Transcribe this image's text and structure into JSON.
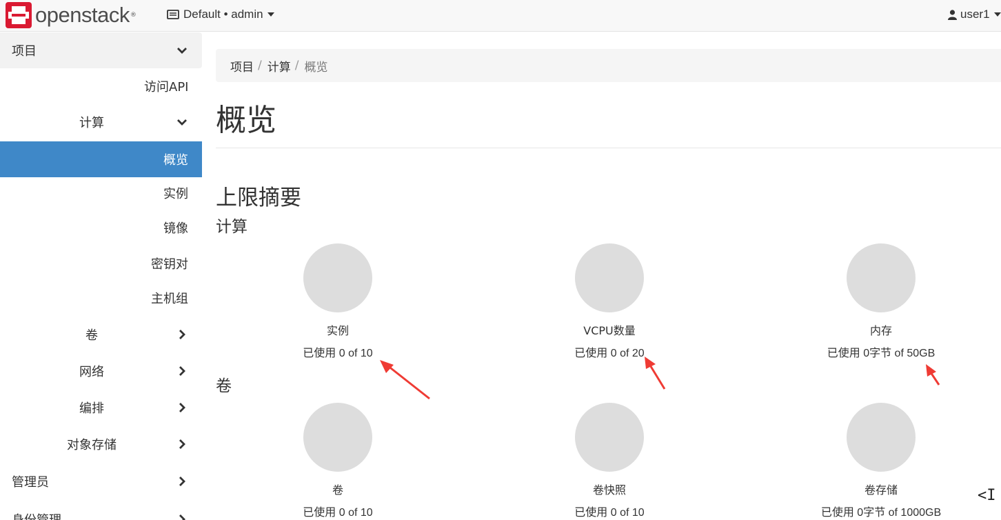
{
  "navbar": {
    "brand": "openstack",
    "brand_mark": "®",
    "project_picker": "Default • admin",
    "user": "user1"
  },
  "sidebar": {
    "project": "项目",
    "access_api": "访问API",
    "compute": "计算",
    "compute_items": [
      "概览",
      "实例",
      "镜像",
      "密钥对",
      "主机组"
    ],
    "volumes": "卷",
    "network": "网络",
    "orchestration": "编排",
    "object_store": "对象存储",
    "admin": "管理员",
    "identity": "身份管理"
  },
  "breadcrumb": [
    "项目",
    "计算",
    "概览"
  ],
  "page_title": "概览",
  "limit_summary": {
    "title": "上限摘要",
    "compute": {
      "title": "计算",
      "items": [
        {
          "label": "实例",
          "usage": "已使用 0 of 10"
        },
        {
          "label": "VCPU数量",
          "usage": "已使用 0 of 20"
        },
        {
          "label": "内存",
          "usage": "已使用 0字节 of 50GB"
        }
      ]
    },
    "volume": {
      "title": "卷",
      "items": [
        {
          "label": "卷",
          "usage": "已使用 0 of 10"
        },
        {
          "label": "卷快照",
          "usage": "已使用 0 of 10"
        },
        {
          "label": "卷存储",
          "usage": "已使用 0字节 of 1000GB"
        }
      ]
    }
  },
  "collapse_toggle": "<I",
  "colors": {
    "active_nav": "#3f88c8",
    "pie_empty": "#dddddd",
    "annotation_arrow": "#ef3b34",
    "logo_red": "#da1a32"
  }
}
